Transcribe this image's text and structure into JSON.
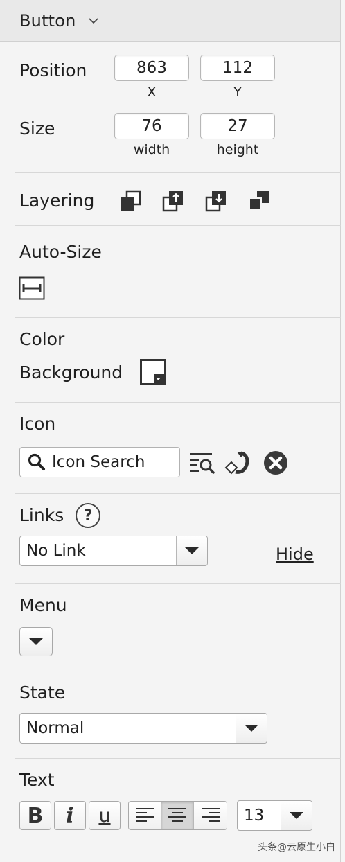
{
  "header": {
    "title": "Button"
  },
  "position": {
    "label": "Position",
    "x_value": "863",
    "x_caption": "X",
    "y_value": "112",
    "y_caption": "Y"
  },
  "size": {
    "label": "Size",
    "width_value": "76",
    "width_caption": "width",
    "height_value": "27",
    "height_caption": "height"
  },
  "layering": {
    "label": "Layering",
    "icons": [
      "bring-to-front-icon",
      "bring-forward-icon",
      "send-backward-icon",
      "send-to-back-icon"
    ]
  },
  "autosize": {
    "label": "Auto-Size"
  },
  "color": {
    "label": "Color",
    "background_label": "Background",
    "background_value": "#ffffff"
  },
  "icon": {
    "label": "Icon",
    "search_placeholder": "Icon Search"
  },
  "links": {
    "label": "Links",
    "help_glyph": "?",
    "selected": "No Link",
    "hide_label": "Hide"
  },
  "menu": {
    "label": "Menu"
  },
  "state": {
    "label": "State",
    "selected": "Normal"
  },
  "text": {
    "label": "Text",
    "bold_glyph": "B",
    "italic_glyph": "i",
    "underline_glyph": "u",
    "font_size": "13",
    "active_alignment": "center"
  },
  "watermark": "头条@云原生小白",
  "colors": {
    "panel_bg": "#f4f4f4",
    "header_bg": "#e9e9e9",
    "icon_dark": "#333333"
  }
}
